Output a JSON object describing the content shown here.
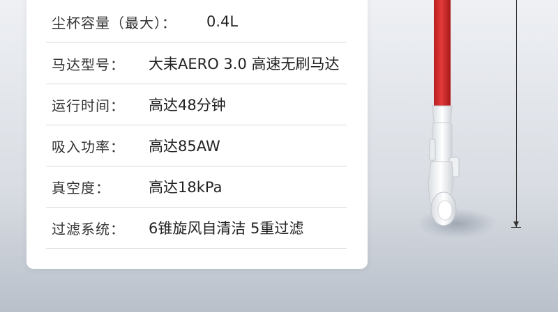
{
  "specs": [
    {
      "label": "尘杯容量（最大）：",
      "value": "0.4L"
    },
    {
      "label": "马达型号：",
      "value": "大耒AERO 3.0 高速无刷马达"
    },
    {
      "label": "运行时间：",
      "value": "高达48分钟"
    },
    {
      "label": "吸入功率：",
      "value": "高达85AW"
    },
    {
      "label": "真空度：",
      "value": "高达18kPa"
    },
    {
      "label": "过滤系统：",
      "value": "6锥旋风自清洁  5重过滤"
    }
  ],
  "colors": {
    "tube_red": "#d62828",
    "body_white": "#f4f5f6",
    "card_bg": "#ffffff"
  }
}
